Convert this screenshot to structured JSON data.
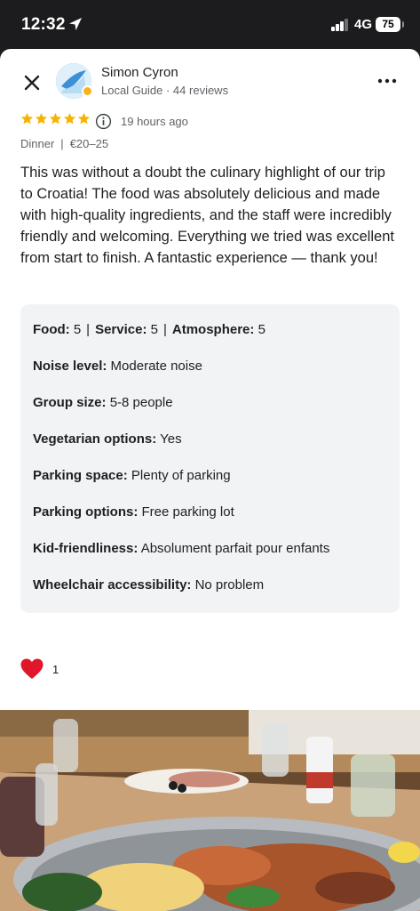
{
  "status": {
    "time": "12:32",
    "network": "4G",
    "battery": "75"
  },
  "reviewer": {
    "name": "Simon Cyron",
    "meta": "Local Guide · 44 reviews"
  },
  "review": {
    "rating": 5,
    "time_ago": "19 hours ago",
    "meal": "Dinner",
    "price": "€20–25",
    "text": "This was without a doubt the culinary highlight of our trip to Croatia! The food was absolutely delicious and made with high-quality ingredients, and the staff were incredibly friendly and welcoming. Everything we tried was excellent from start to finish. A fantastic experience — thank you!"
  },
  "ratings": {
    "food_label": "Food:",
    "food_value": "5",
    "service_label": "Service:",
    "service_value": "5",
    "atmosphere_label": "Atmosphere:",
    "atmosphere_value": "5"
  },
  "details": [
    {
      "label": "Noise level:",
      "value": "Moderate noise"
    },
    {
      "label": "Group size:",
      "value": "5-8 people"
    },
    {
      "label": "Vegetarian options:",
      "value": "Yes"
    },
    {
      "label": "Parking space:",
      "value": "Plenty of parking"
    },
    {
      "label": "Parking options:",
      "value": "Free parking lot"
    },
    {
      "label": "Kid-friendliness:",
      "value": "Absolument parfait pour enfants"
    },
    {
      "label": "Wheelchair accessibility:",
      "value": "No problem"
    }
  ],
  "reactions": {
    "icon": "heart-icon",
    "count": "1"
  },
  "colors": {
    "star": "#f5b400",
    "heart": "#e0162b",
    "panel": "#f1f3f4"
  }
}
